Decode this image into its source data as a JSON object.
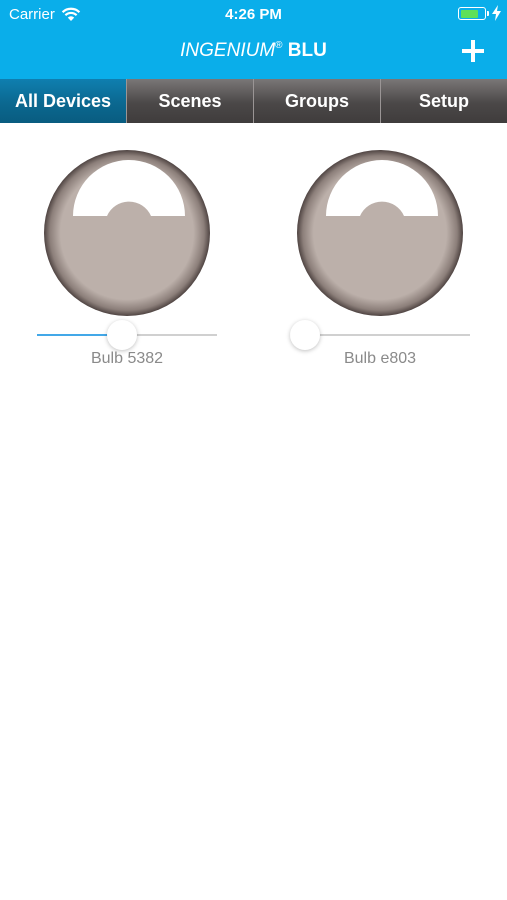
{
  "status": {
    "carrier": "Carrier",
    "time": "4:26 PM",
    "battery_level": 0.8
  },
  "nav": {
    "brand": "INGENIUM",
    "reg": "®",
    "title_strong": "BLU"
  },
  "tabs": [
    {
      "label": "All Devices",
      "active": true
    },
    {
      "label": "Scenes",
      "active": false
    },
    {
      "label": "Groups",
      "active": false
    },
    {
      "label": "Setup",
      "active": false
    }
  ],
  "devices": [
    {
      "name": "Bulb 5382",
      "brightness": 0.47
    },
    {
      "name": "Bulb e803",
      "brightness": 0.0
    }
  ],
  "colors": {
    "accent": "#0aaeea",
    "active_tab": "#0b6890",
    "slider_fill": "#43a8e8",
    "bulb_face": "#bcb0aa",
    "bulb_rim": "#5d5250"
  }
}
